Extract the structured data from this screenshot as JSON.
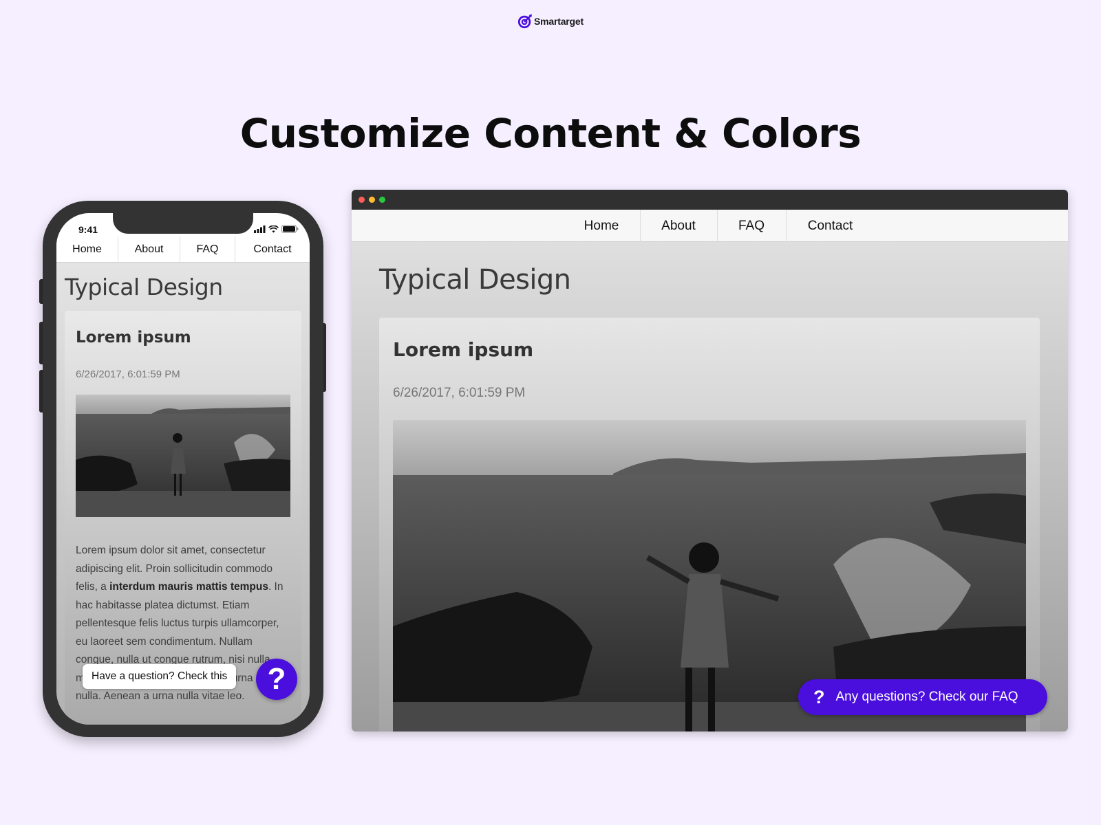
{
  "brand": {
    "name": "Smartarget",
    "accent": "#4a0fdc"
  },
  "headline": "Customize Content & Colors",
  "mobile": {
    "time": "9:41",
    "nav": [
      "Home",
      "About",
      "FAQ",
      "Contact"
    ],
    "page_title": "Typical Design",
    "card": {
      "title": "Lorem ipsum",
      "date": "6/26/2017, 6:01:59 PM",
      "body_part1": "Lorem ipsum dolor sit amet, consectetur adipiscing elit. Proin sollicitudin commodo felis, a ",
      "body_bold": "interdum mauris mattis tempus",
      "body_part2": ". In hac habitasse platea dictumst. Etiam pellentesque felis luctus turpis ullamcorper, eu laoreet sem condimentum. Nullam congue, nulla ut congue rutrum, nisi nulla molestie nisl, vitae dapibus nulla urna eget nulla. Aenean a urna nulla vitae leo."
    },
    "chat_prompt": "Have a question? Check this",
    "fab_icon": "?"
  },
  "desktop": {
    "nav": [
      "Home",
      "About",
      "FAQ",
      "Contact"
    ],
    "page_title": "Typical Design",
    "card": {
      "title": "Lorem ipsum",
      "date": "6/26/2017, 6:01:59 PM"
    },
    "faq_button": "Any questions? Check our FAQ",
    "faq_icon": "?"
  }
}
